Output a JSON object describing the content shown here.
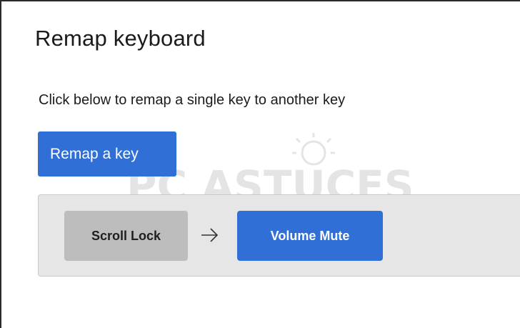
{
  "dialog": {
    "title": "Remap keyboard",
    "subtitle": "Click below to remap a single key to another key",
    "remap_button_label": "Remap a key"
  },
  "mapping": {
    "original_key": "Scroll Lock",
    "arrow_icon": "arrow-right-icon",
    "target_key": "Volume Mute"
  },
  "watermark": {
    "text": "PC ASTUCES"
  },
  "colors": {
    "accent": "#2f6fd6",
    "row_background": "#e6e6e6",
    "original_key_background": "#bdbdbd",
    "text": "#1b1b1b"
  }
}
